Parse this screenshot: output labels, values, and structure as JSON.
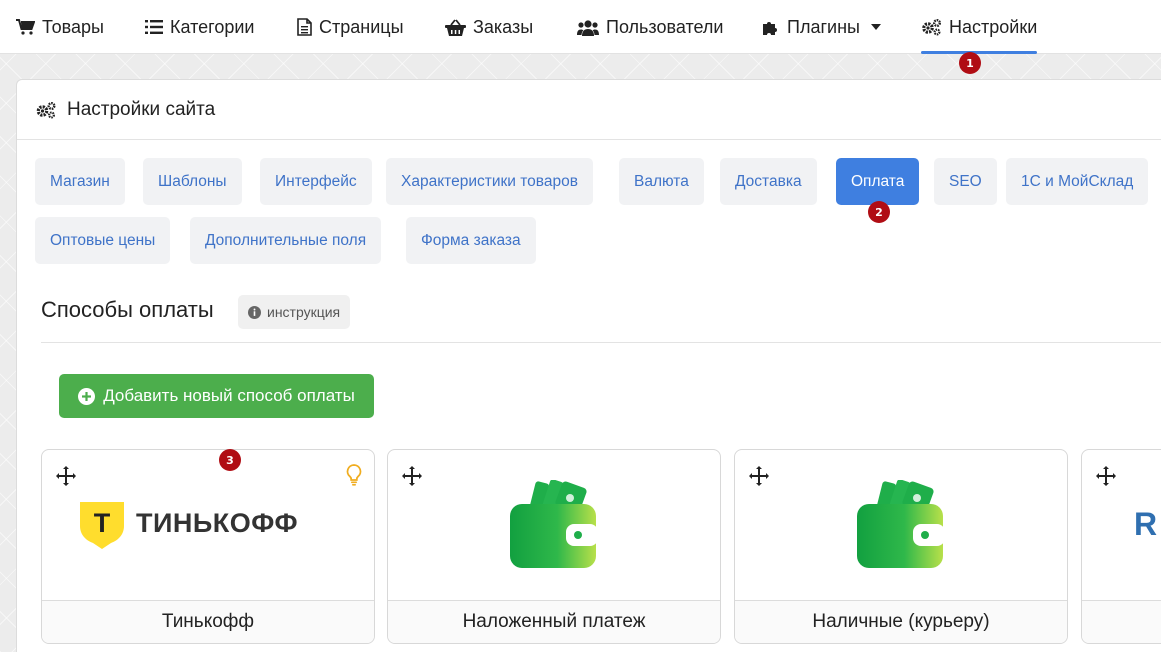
{
  "nav": {
    "items": [
      {
        "label": "Товары",
        "icon": "cart-icon"
      },
      {
        "label": "Категории",
        "icon": "list-icon"
      },
      {
        "label": "Страницы",
        "icon": "file-icon"
      },
      {
        "label": "Заказы",
        "icon": "basket-icon"
      },
      {
        "label": "Пользователи",
        "icon": "users-icon"
      },
      {
        "label": "Плагины",
        "icon": "puzzle-icon"
      },
      {
        "label": "Настройки",
        "icon": "cogs-icon"
      }
    ]
  },
  "markers": [
    "1",
    "2",
    "3"
  ],
  "card": {
    "title": "Настройки сайта"
  },
  "tabs": [
    "Магазин",
    "Шаблоны",
    "Интерфейс",
    "Характеристики товаров",
    "Валюта",
    "Доставка",
    "Оплата",
    "SEO",
    "1С и МойСклад",
    "Оптовые цены",
    "Дополнительные поля",
    "Форма заказа"
  ],
  "active_tab": "Оплата",
  "section": {
    "title": "Способы оплаты",
    "instruction_label": "инструкция",
    "add_button_label": "Добавить новый способ оплаты"
  },
  "payment_methods": [
    {
      "name": "Тинькофф",
      "logo_text": "ТИНЬКОФФ",
      "logo_letter": "Т"
    },
    {
      "name": "Наложенный платеж"
    },
    {
      "name": "Наличные (курьеру)"
    },
    {
      "name": "",
      "logo_text": "R"
    }
  ],
  "colors": {
    "accent": "#3f7fe0",
    "add_button": "#4cae4c",
    "marker": "#b00d14",
    "tinkoff_yellow": "#ffdd2d",
    "wallet_green": "#1fae4a"
  }
}
